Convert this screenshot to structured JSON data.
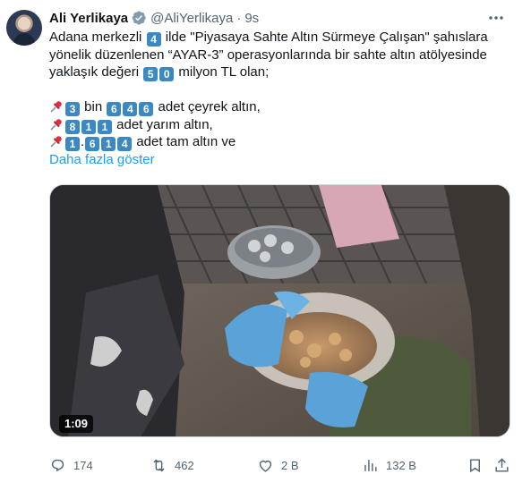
{
  "author": {
    "name": "Ali Yerlikaya",
    "handle": "@AliYerlikaya",
    "separator": "·",
    "time": "9s"
  },
  "text": {
    "l1": {
      "a": "Adana merkezli ",
      "k1": "4",
      "b": " ilde \"Piyasaya Sahte Altın Sürmeye Çalışan\" şahıslara"
    },
    "l2": "yönelik düzenlenen “AYAR-3” operasyonlarında bir sahte altın atölyesinde",
    "l3": {
      "a": "yaklaşık değeri ",
      "k1": "5",
      "k2": "0",
      "b": " milyon TL olan;"
    },
    "l4": {
      "k1": "3",
      "a": " bin ",
      "k2": "6",
      "k3": "4",
      "k4": "6",
      "b": " adet çeyrek altın,"
    },
    "l5": {
      "k1": "8",
      "k2": "1",
      "k3": "1",
      "b": " adet yarım altın,"
    },
    "l6": {
      "k1": "1",
      "a": ".",
      "k2": "6",
      "k3": "1",
      "k4": "4",
      "b": " adet tam altın ve"
    },
    "show_more": "Daha fazla göster"
  },
  "media": {
    "duration": "1:09"
  },
  "actions": {
    "replies": "174",
    "reposts": "462",
    "likes": "2 B",
    "views": "132 B"
  },
  "colors": {
    "accent": "#1d9bf0",
    "muted": "#536471",
    "keycap": "#3b88c3",
    "verified": "#829aab"
  }
}
